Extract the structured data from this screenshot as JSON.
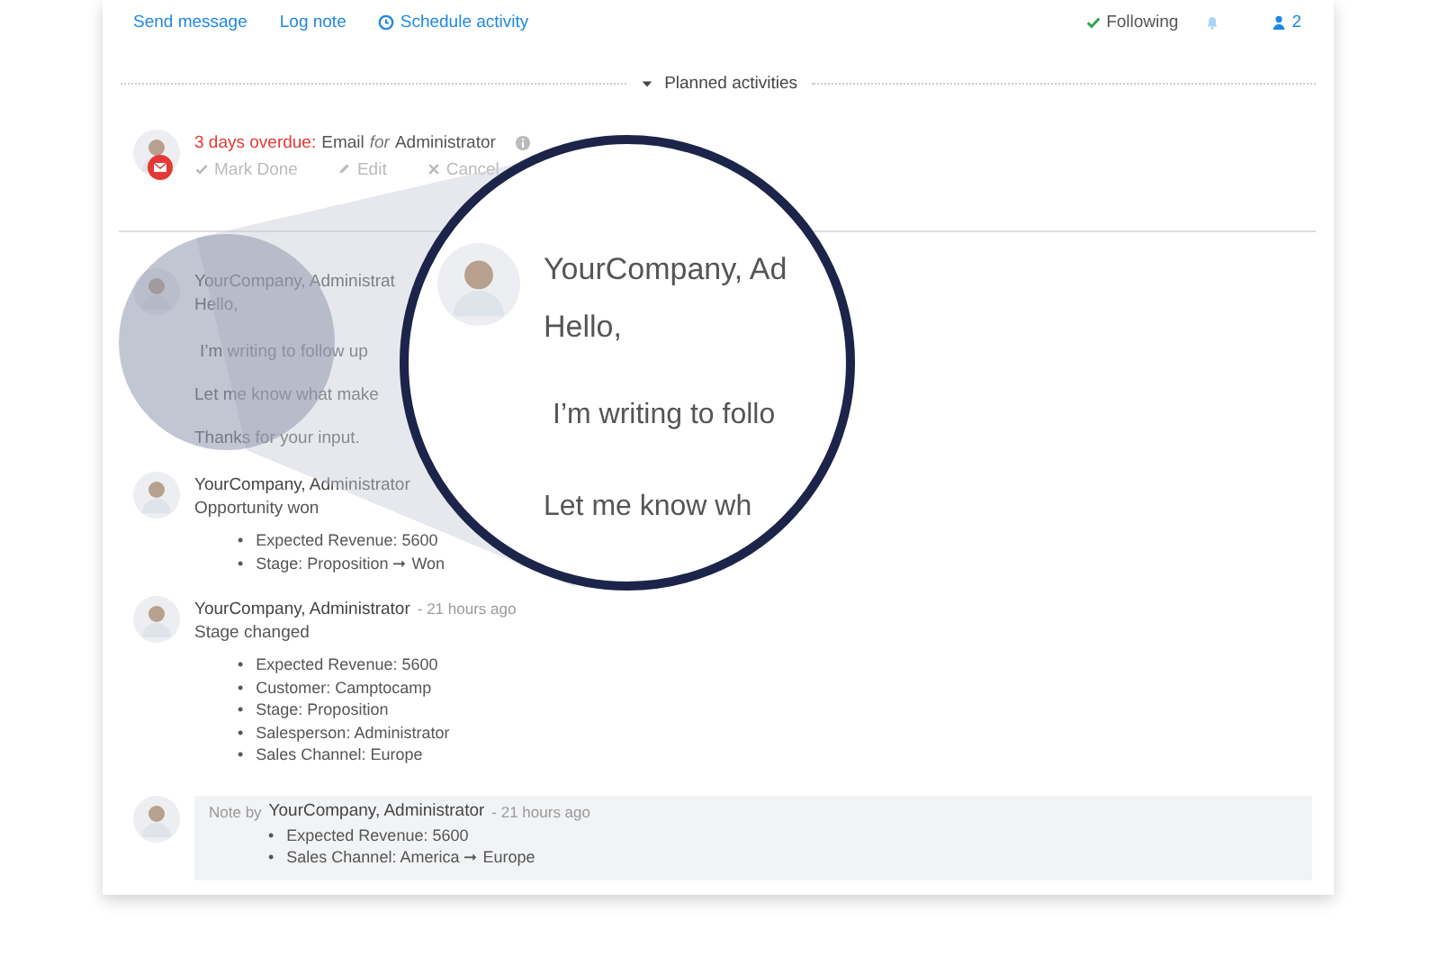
{
  "toolbar": {
    "actions": [
      {
        "label": "Send message"
      },
      {
        "label": "Log note"
      },
      {
        "label": "Schedule activity"
      }
    ],
    "following": "Following",
    "followers": "2"
  },
  "planned": {
    "title": "Planned activities",
    "expanded": true,
    "activity": {
      "overdue": "3 days overdue:",
      "type": "Email",
      "for": "for",
      "assignee": "Administrator",
      "actions": [
        {
          "label": "Mark Done"
        },
        {
          "label": "Edit"
        },
        {
          "label": "Cancel"
        }
      ]
    }
  },
  "messages": [
    {
      "kind": "message",
      "author": "YourCompany, Administrat",
      "lines": [
        "Hello,",
        "I’m writing to follow up",
        "Let me know what make",
        "Thanks for your input."
      ]
    },
    {
      "kind": "tracking",
      "author": "YourCompany, Administrator",
      "subtitle": "Opportunity won",
      "changes": [
        {
          "marker": "•",
          "text": "Expected Revenue: 5600"
        },
        {
          "marker": "•",
          "text": "Stage: Proposition ➞ Won"
        }
      ]
    },
    {
      "kind": "tracking",
      "author": "YourCompany, Administrator",
      "time": "- 21 hours ago",
      "subtitle": "Stage changed",
      "changes": [
        {
          "marker": "•",
          "text": "Expected Revenue: 5600"
        },
        {
          "marker": "•",
          "text": "Customer: Camptocamp"
        },
        {
          "marker": "•",
          "text": "Stage: Proposition"
        },
        {
          "marker": "•",
          "text": "Salesperson: Administrator"
        },
        {
          "marker": "•",
          "text": "Sales Channel: Europe"
        }
      ]
    },
    {
      "kind": "note",
      "prefix": "Note by",
      "author": "YourCompany, Administrator",
      "time": "- 21 hours ago",
      "changes": [
        {
          "marker": "•",
          "text": "Expected Revenue: 5600"
        },
        {
          "marker": "•",
          "text": "Sales Channel: America ➞ Europe"
        }
      ]
    }
  ],
  "magnifier": {
    "author": "YourCompany, Ad",
    "lines": [
      "Hello,",
      "I’m writing to follo",
      "Let me know wh"
    ]
  }
}
